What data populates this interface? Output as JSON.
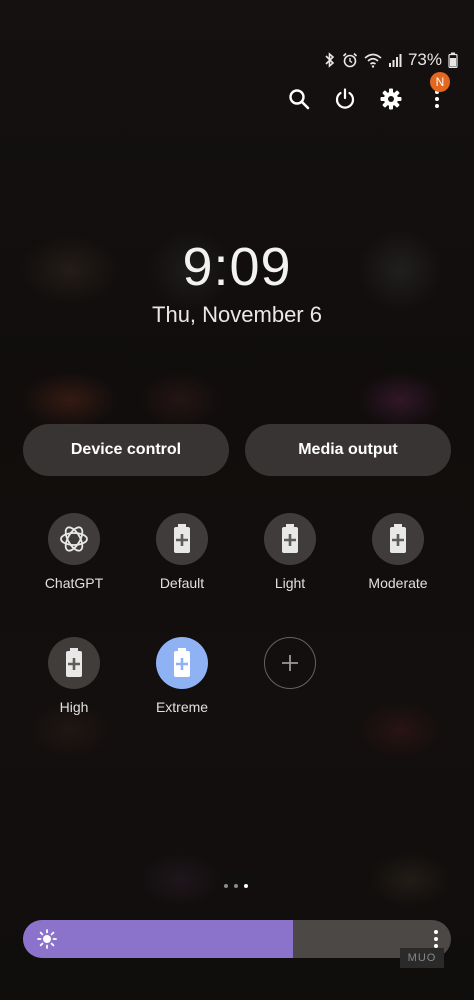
{
  "status_bar": {
    "battery_percent": "73%",
    "icons": [
      "bluetooth-icon",
      "alarm-icon",
      "wifi-icon",
      "signal-icon",
      "battery-icon"
    ]
  },
  "top_icons": {
    "items": [
      "search-icon",
      "power-icon",
      "settings-icon",
      "more-icon"
    ],
    "notification_badge": "N"
  },
  "clock": {
    "time": "9:09",
    "date": "Thu, November 6"
  },
  "buttons": {
    "device_control": "Device control",
    "media_output": "Media output"
  },
  "tiles": [
    {
      "label": "ChatGPT",
      "icon": "chatgpt-icon",
      "active": false
    },
    {
      "label": "Default",
      "icon": "battery-plus-icon",
      "active": false
    },
    {
      "label": "Light",
      "icon": "battery-plus-icon",
      "active": false
    },
    {
      "label": "Moderate",
      "icon": "battery-plus-icon",
      "active": false
    },
    {
      "label": "High",
      "icon": "battery-plus-icon",
      "active": false
    },
    {
      "label": "Extreme",
      "icon": "battery-plus-icon",
      "active": true
    }
  ],
  "add_tile_icon": "plus-icon",
  "page_indicator": {
    "total": 3,
    "current": 3
  },
  "brightness": {
    "level": 0.63,
    "icon": "sun-icon",
    "menu_icon": "more-vertical-icon"
  },
  "watermark": "MUO",
  "colors": {
    "active_tile": "#8fb2f5",
    "brightness_fill": "#8b73cc",
    "badge": "#e3671f"
  }
}
